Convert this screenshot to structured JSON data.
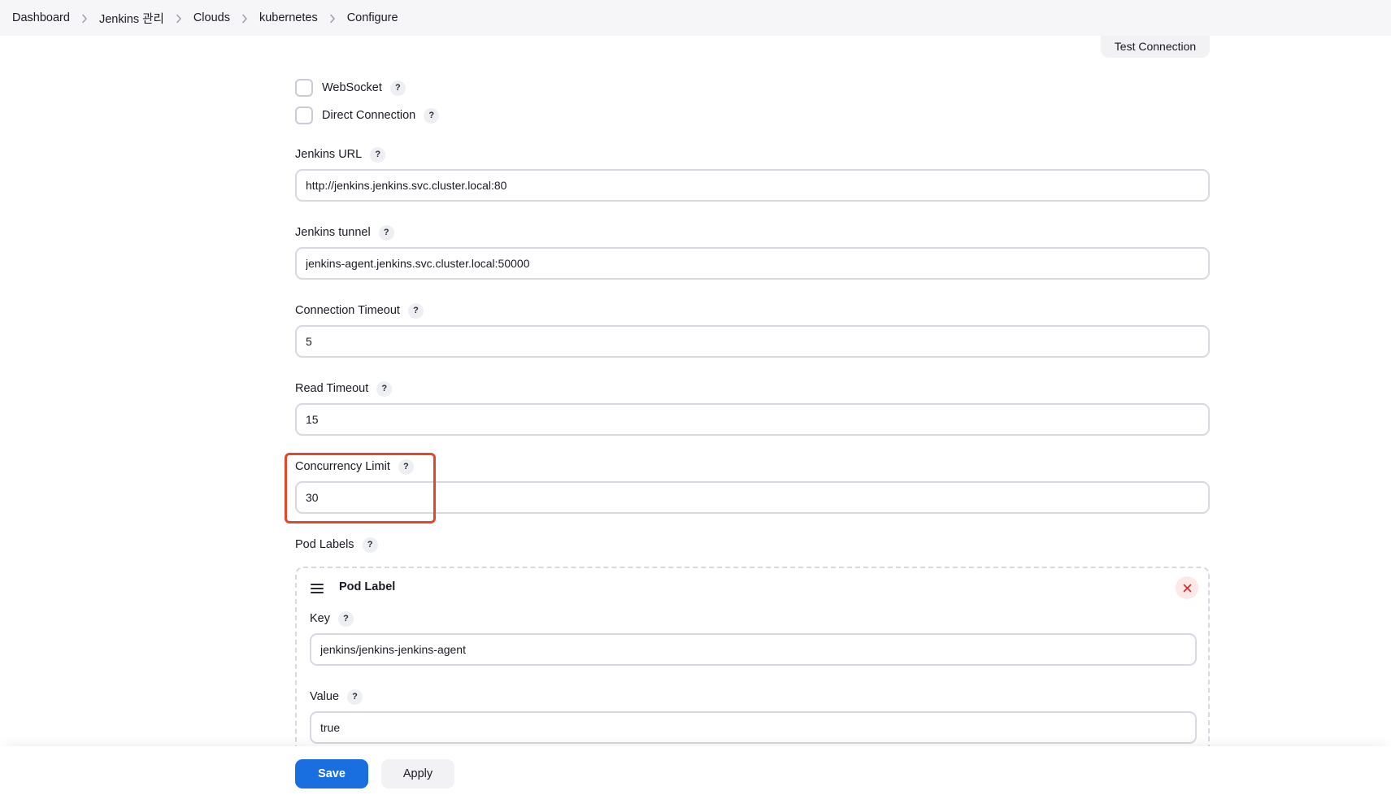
{
  "breadcrumb": {
    "items": [
      "Dashboard",
      "Jenkins 관리",
      "Clouds",
      "kubernetes",
      "Configure"
    ]
  },
  "toolbar": {
    "test_connection_label": "Test Connection"
  },
  "form": {
    "websocket": {
      "label": "WebSocket",
      "checked": false
    },
    "direct_connection": {
      "label": "Direct Connection",
      "checked": false
    },
    "jenkins_url": {
      "label": "Jenkins URL",
      "value": "http://jenkins.jenkins.svc.cluster.local:80"
    },
    "jenkins_tunnel": {
      "label": "Jenkins tunnel",
      "value": "jenkins-agent.jenkins.svc.cluster.local:50000"
    },
    "connection_timeout": {
      "label": "Connection Timeout",
      "value": "5"
    },
    "read_timeout": {
      "label": "Read Timeout",
      "value": "15"
    },
    "concurrency_limit": {
      "label": "Concurrency Limit",
      "value": "30"
    },
    "pod_labels": {
      "label": "Pod Labels",
      "items": [
        {
          "title": "Pod Label",
          "key_label": "Key",
          "key_value": "jenkins/jenkins-jenkins-agent",
          "value_label": "Value",
          "value_value": "true"
        }
      ]
    }
  },
  "help_glyph": "?",
  "actions": {
    "save_label": "Save",
    "apply_label": "Apply"
  },
  "colors": {
    "primary": "#1a6fe0",
    "highlight": "#e4472a",
    "danger": "#d42a2a"
  }
}
